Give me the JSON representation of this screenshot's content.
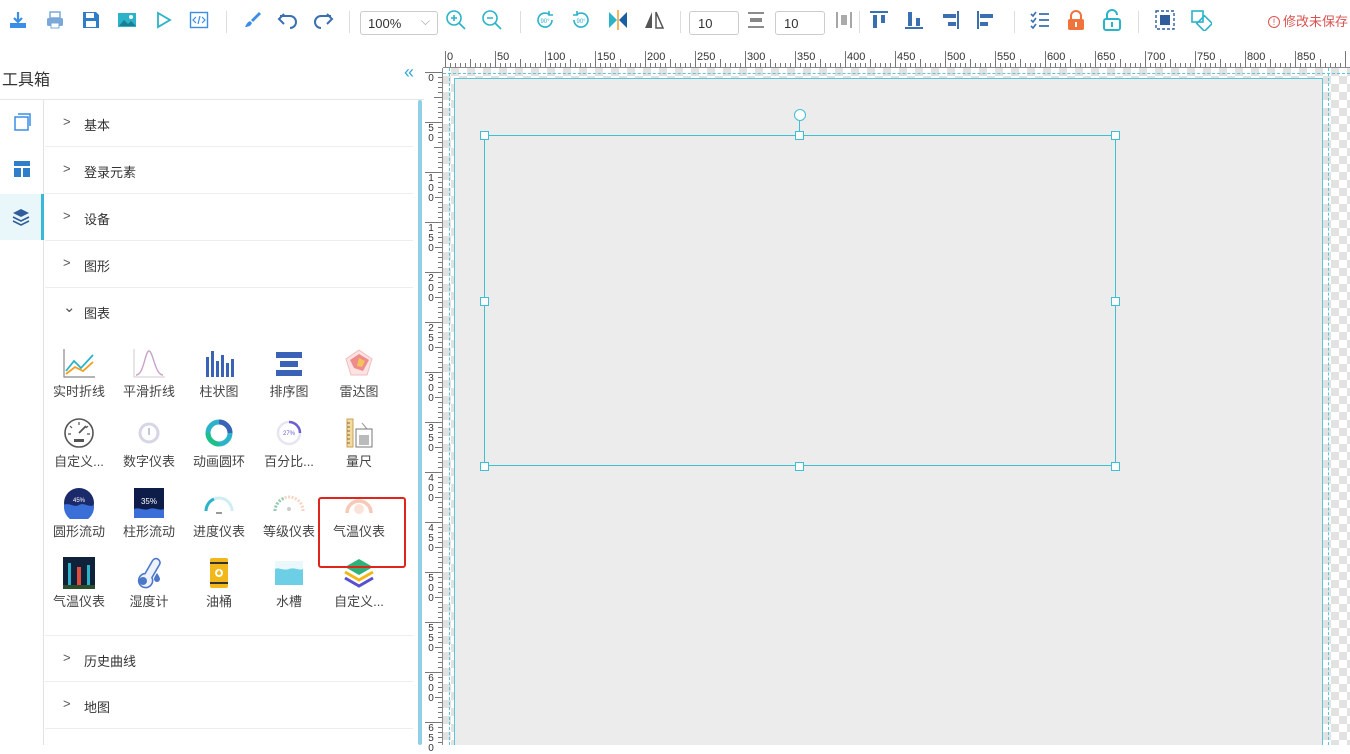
{
  "toolbar": {
    "icons": [
      "download-icon",
      "print-icon",
      "save-icon",
      "image-icon",
      "preview-icon",
      "code-icon",
      "brush-icon",
      "undo-icon",
      "redo-icon",
      "zoom-in-icon",
      "zoom-out-icon",
      "rotate-right-90-icon",
      "rotate-left-90-icon",
      "flip-horizontal-icon",
      "mirror-icon",
      "distribute-horizontal-icon",
      "align-top-icon",
      "align-bottom-icon",
      "align-right-icon",
      "align-left-icon",
      "checklist-icon",
      "lock-icon",
      "unlock-icon",
      "group-icon",
      "ungroup-icon"
    ],
    "zoom_value": "100%",
    "spacing_h": "10",
    "spacing_v": "10",
    "unsaved_label": "修改未保存",
    "colors": {
      "primary": "#3a8ee6",
      "accent": "#2bb3c9",
      "warning": "#f0733b",
      "danger": "#d9534f"
    }
  },
  "panel": {
    "title": "工具箱",
    "collapse_glyph": "«",
    "rail": [
      "layers-copy-icon",
      "layout-icon",
      "stack-icon"
    ],
    "categories": [
      {
        "label": "基本",
        "glyph": ">"
      },
      {
        "label": "登录元素",
        "glyph": ">"
      },
      {
        "label": "设备",
        "glyph": ">"
      },
      {
        "label": "图形",
        "glyph": ">"
      },
      {
        "label": "图表",
        "glyph": "⌄"
      },
      {
        "label": "历史曲线",
        "glyph": ">"
      },
      {
        "label": "地图",
        "glyph": ">"
      }
    ],
    "chart_items": [
      {
        "label": "实时折线",
        "icon": "line-chart-icon"
      },
      {
        "label": "平滑折线",
        "icon": "smooth-line-icon"
      },
      {
        "label": "柱状图",
        "icon": "bar-chart-icon"
      },
      {
        "label": "排序图",
        "icon": "sort-chart-icon"
      },
      {
        "label": "雷达图",
        "icon": "radar-chart-icon"
      },
      {
        "label": "自定义...",
        "icon": "custom-gauge-icon"
      },
      {
        "label": "数字仪表",
        "icon": "digital-gauge-icon"
      },
      {
        "label": "动画圆环",
        "icon": "animated-ring-icon"
      },
      {
        "label": "百分比...",
        "icon": "percent-ring-icon"
      },
      {
        "label": "量尺",
        "icon": "ruler-icon"
      },
      {
        "label": "圆形流动",
        "icon": "circle-flow-icon"
      },
      {
        "label": "柱形流动",
        "icon": "bar-flow-icon"
      },
      {
        "label": "进度仪表",
        "icon": "progress-gauge-icon"
      },
      {
        "label": "等级仪表",
        "icon": "level-gauge-icon"
      },
      {
        "label": "气温仪表",
        "icon": "temp-gauge-icon"
      },
      {
        "label": "气温仪表",
        "icon": "temp-bars-icon"
      },
      {
        "label": "湿度计",
        "icon": "hygrometer-icon"
      },
      {
        "label": "油桶",
        "icon": "oil-barrel-icon"
      },
      {
        "label": "水槽",
        "icon": "water-tank-icon"
      },
      {
        "label": "自定义...",
        "icon": "custom-layers-icon"
      }
    ],
    "tile_texts": {
      "circle_flow": "45%",
      "bar_flow": "35%",
      "percent": "27%"
    }
  },
  "canvas": {
    "ruler_top": [
      "0",
      "50",
      "100",
      "150",
      "200",
      "250",
      "300",
      "350",
      "400",
      "450",
      "500",
      "550",
      "600",
      "650",
      "700",
      "750",
      "800",
      "850"
    ],
    "ruler_left": [
      "0",
      "5 0",
      "1 0 0",
      "1 5 0",
      "2 0 0",
      "2 5 0",
      "3 0 0",
      "3 5 0",
      "4 0 0",
      "4 5 0",
      "5 0 0",
      "5 5 0",
      "6 0 0",
      "6 5 0"
    ]
  }
}
